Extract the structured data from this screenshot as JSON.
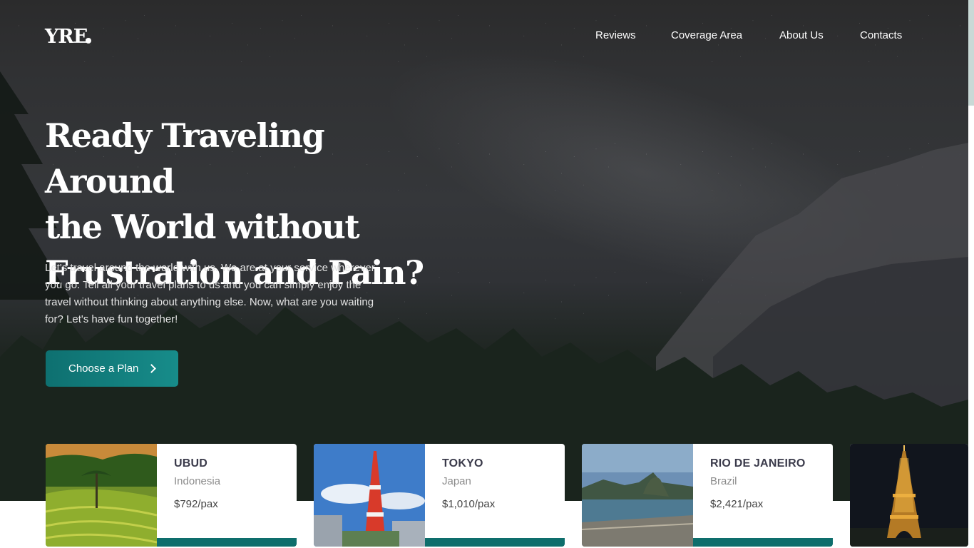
{
  "brand": {
    "logo": "YRE"
  },
  "nav": {
    "items": [
      "Reviews",
      "Coverage Area",
      "About Us",
      "Contacts"
    ]
  },
  "hero": {
    "headline_lines": [
      "Ready Traveling Around",
      "the World without",
      "Frustration and Pain?"
    ],
    "description": "Let's travel around the world with us. We are at your service wherever you go. Tell all your travel plans to us and you can simply enjoy the travel without thinking about anything else. Now, what are you waiting for? Let's have fun together!",
    "cta_label": "Choose a Plan"
  },
  "destinations": [
    {
      "city": "UBUD",
      "country": "Indonesia",
      "price": "$792/pax"
    },
    {
      "city": "TOKYO",
      "country": "Japan",
      "price": "$1,010/pax"
    },
    {
      "city": "RIO DE JANEIRO",
      "country": "Brazil",
      "price": "$2,421/pax"
    },
    {
      "city": "",
      "country": "",
      "price": ""
    }
  ],
  "colors": {
    "accent": "#0e6e6c",
    "hero_dark": "#2f3033"
  }
}
